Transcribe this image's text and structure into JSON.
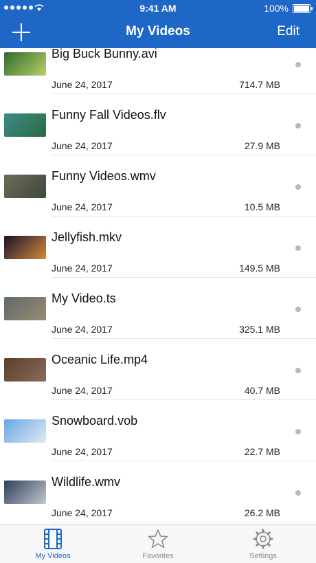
{
  "status_bar": {
    "time": "9:41 AM",
    "battery": "100%"
  },
  "nav": {
    "title": "My Videos",
    "edit_label": "Edit",
    "add_icon": "plus-icon"
  },
  "videos": [
    {
      "title": "Big Buck Bunny.avi",
      "date": "June 24, 2017",
      "size": "714.7 MB",
      "thumb_colors": [
        "#2e6b2b",
        "#b7d06b"
      ]
    },
    {
      "title": "Funny Fall Videos.flv",
      "date": "June 24, 2017",
      "size": "27.9 MB",
      "thumb_colors": [
        "#3c8b86",
        "#2d6a44"
      ]
    },
    {
      "title": "Funny Videos.wmv",
      "date": "June 24, 2017",
      "size": "10.5 MB",
      "thumb_colors": [
        "#6f6b5a",
        "#3b4a3a"
      ]
    },
    {
      "title": "Jellyfish.mkv",
      "date": "June 24, 2017",
      "size": "149.5 MB",
      "thumb_colors": [
        "#1a0f2b",
        "#d28a3a"
      ]
    },
    {
      "title": "My Video.ts",
      "date": "June 24, 2017",
      "size": "325.1 MB",
      "thumb_colors": [
        "#5e6a6c",
        "#9a8a6e"
      ]
    },
    {
      "title": "Oceanic Life.mp4",
      "date": "June 24, 2017",
      "size": "40.7 MB",
      "thumb_colors": [
        "#5a3f2a",
        "#8b6a5b"
      ]
    },
    {
      "title": "Snowboard.vob",
      "date": "June 24, 2017",
      "size": "22.7 MB",
      "thumb_colors": [
        "#6aa7e5",
        "#dfe8f2"
      ]
    },
    {
      "title": "Wildlife.wmv",
      "date": "June 24, 2017",
      "size": "26.2 MB",
      "thumb_colors": [
        "#2e3f5c",
        "#c2c6c9"
      ]
    }
  ],
  "tabs": [
    {
      "label": "My Videos",
      "icon": "film-icon",
      "active": true
    },
    {
      "label": "Favorites",
      "icon": "star-icon",
      "active": false
    },
    {
      "label": "Settings",
      "icon": "gear-icon",
      "active": false
    }
  ],
  "colors": {
    "accent": "#1f67c6",
    "inactive": "#8a8a8a",
    "separator": "#e5e5e5"
  }
}
